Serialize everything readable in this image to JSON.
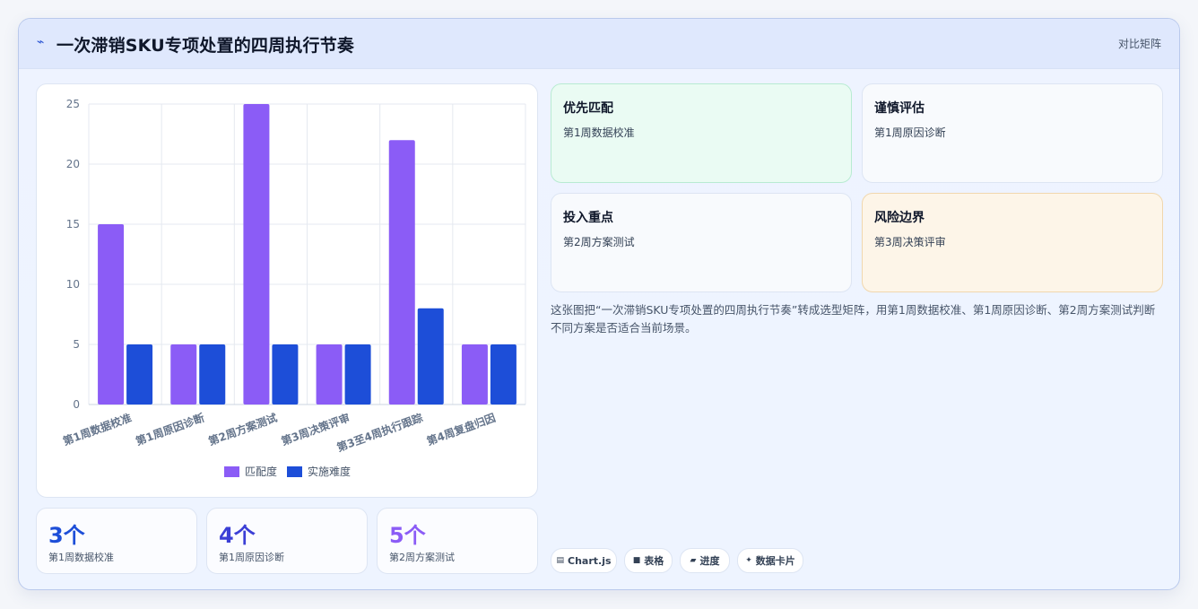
{
  "header": {
    "icon": "bolt-icon",
    "title": "一次滞销SKU专项处置的四周执行节奏",
    "tag": "对比矩阵"
  },
  "chart_data": {
    "type": "bar",
    "categories": [
      "第1周数据校准",
      "第1周原因诊断",
      "第2周方案测试",
      "第3周决策评审",
      "第3至4周执行跟踪",
      "第4周复盘归因"
    ],
    "series": [
      {
        "name": "匹配度",
        "color": "#8b5cf6",
        "values": [
          15,
          5,
          25,
          5,
          22,
          5
        ]
      },
      {
        "name": "实施难度",
        "color": "#1d4ed8",
        "values": [
          5,
          5,
          5,
          5,
          8,
          5
        ]
      }
    ],
    "ylim": [
      0,
      25
    ],
    "yticks": [
      0,
      5,
      10,
      15,
      20,
      25
    ],
    "grid": true,
    "legend": "bottom"
  },
  "stats": [
    {
      "value": "3个",
      "label": "第1周数据校准",
      "color": "#1d4ed8"
    },
    {
      "value": "4个",
      "label": "第1周原因诊断",
      "color": "#3b3fd6"
    },
    {
      "value": "5个",
      "label": "第2周方案测试",
      "color": "#8b5cf6"
    }
  ],
  "matrix": [
    {
      "title": "优先匹配",
      "sub": "第1周数据校准"
    },
    {
      "title": "谨慎评估",
      "sub": "第1周原因诊断"
    },
    {
      "title": "投入重点",
      "sub": "第2周方案测试"
    },
    {
      "title": "风险边界",
      "sub": "第3周决策评审"
    }
  ],
  "description": "这张图把“一次滞销SKU专项处置的四周执行节奏”转成选型矩阵，用第1周数据校准、第1周原因诊断、第2周方案测试判断不同方案是否适合当前场景。",
  "chips": [
    {
      "icon": "chart-icon",
      "glyph": "▤",
      "label": "Chart.js"
    },
    {
      "icon": "table-icon",
      "glyph": "■",
      "label": "表格"
    },
    {
      "icon": "progress-icon",
      "glyph": "▰",
      "label": "进度"
    },
    {
      "icon": "card-icon",
      "glyph": "✦",
      "label": "数据卡片"
    }
  ]
}
